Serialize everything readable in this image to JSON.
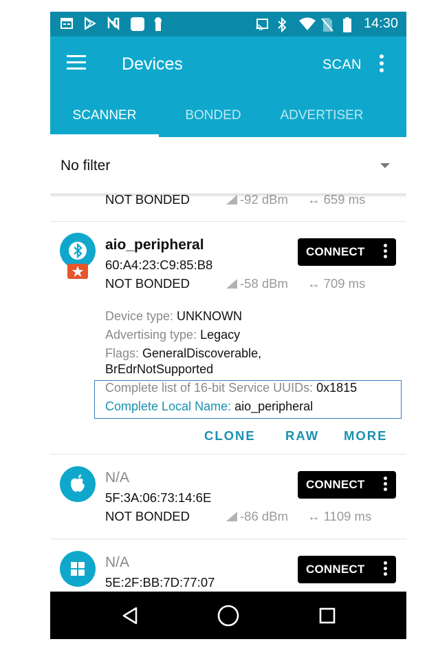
{
  "status_bar": {
    "left_icons": [
      "calendar-icon",
      "play-store-icon",
      "nfc-icon",
      "app-square-icon",
      "keyhole-icon"
    ],
    "right_icons": [
      "cast-icon",
      "bluetooth-icon",
      "wifi-icon",
      "no-sim-icon",
      "battery-icon"
    ],
    "time": "14:30"
  },
  "app_bar": {
    "title": "Devices",
    "scan_label": "SCAN",
    "tabs": [
      {
        "label": "SCANNER",
        "active": true
      },
      {
        "label": "BONDED",
        "active": false
      },
      {
        "label": "ADVERTISER",
        "active": false
      }
    ]
  },
  "filter": {
    "label": "No filter"
  },
  "devices": [
    {
      "bond": "NOT BONDED",
      "rssi": "-92 dBm",
      "interval": "↔ 659 ms"
    },
    {
      "name": "aio_peripheral",
      "address": "60:A4:23:C9:85:B8",
      "bond": "NOT BONDED",
      "rssi": "-58 dBm",
      "interval": "↔ 709 ms",
      "connect": "CONNECT",
      "icon": "bluetooth-icon",
      "badge_icon": "star-icon",
      "details": {
        "device_type_key": "Device type: ",
        "device_type_val": "UNKNOWN",
        "adv_type_key": "Advertising type: ",
        "adv_type_val": "Legacy",
        "flags_key": "Flags: ",
        "flags_val": "GeneralDiscoverable,",
        "flags_val2": "BrEdrNotSupported",
        "uuids_key": "Complete list of 16-bit Service UUIDs: ",
        "uuids_val": "0x1815",
        "local_name_key": "Complete Local Name: ",
        "local_name_val": "aio_peripheral"
      },
      "actions": [
        "CLONE",
        "RAW",
        "MORE"
      ]
    },
    {
      "name": "N/A",
      "address": "5F:3A:06:73:14:6E",
      "bond": "NOT BONDED",
      "rssi": "-86 dBm",
      "interval": "↔ 1109 ms",
      "connect": "CONNECT",
      "icon": "apple-icon"
    },
    {
      "name": "N/A",
      "address": "5E:2F:BB:7D:77:07",
      "connect": "CONNECT",
      "icon": "windows-icon"
    }
  ],
  "nav_bar": {
    "icons": [
      "back-icon",
      "home-icon",
      "recents-icon"
    ]
  },
  "colors": {
    "primary": "#0fa8cc",
    "status_bar": "#0a8aa8",
    "accent_text": "#1a91b0",
    "badge": "#e5562b"
  }
}
